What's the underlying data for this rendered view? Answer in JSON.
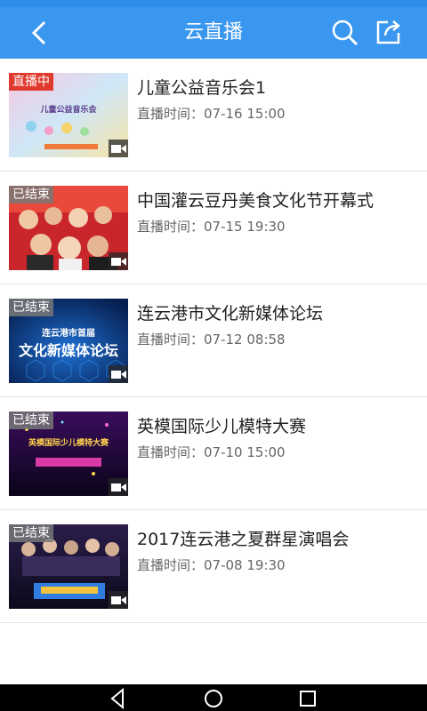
{
  "header": {
    "title": "云直播"
  },
  "icons": {
    "back": "back-arrow-icon",
    "search": "search-icon",
    "share": "share-icon"
  },
  "colors": {
    "appbar": "#3a97ef",
    "live_badge": "#e03a2f",
    "ended_badge": "#787878"
  },
  "items": [
    {
      "status": "直播中",
      "title": "儿童公益音乐会1",
      "time": "直播时间：07-16 15:00",
      "thumb_title": "儿童公益音乐会"
    },
    {
      "status": "已结束",
      "title": "中国灌云豆丹美食文化节开幕式",
      "time": "直播时间：07-15 19:30"
    },
    {
      "status": "已结束",
      "title": "连云港市文化新媒体论坛",
      "time": "直播时间：07-12 08:58",
      "thumb_line1": "连云港市首届",
      "thumb_line2": "文化新媒体论坛"
    },
    {
      "status": "已结束",
      "title": "英模国际少儿模特大赛",
      "time": "直播时间：07-10 15:00",
      "thumb_title": "英模国际少儿模特大赛"
    },
    {
      "status": "已结束",
      "title": "2017连云港之夏群星演唱会",
      "time": "直播时间：07-08 19:30"
    }
  ]
}
